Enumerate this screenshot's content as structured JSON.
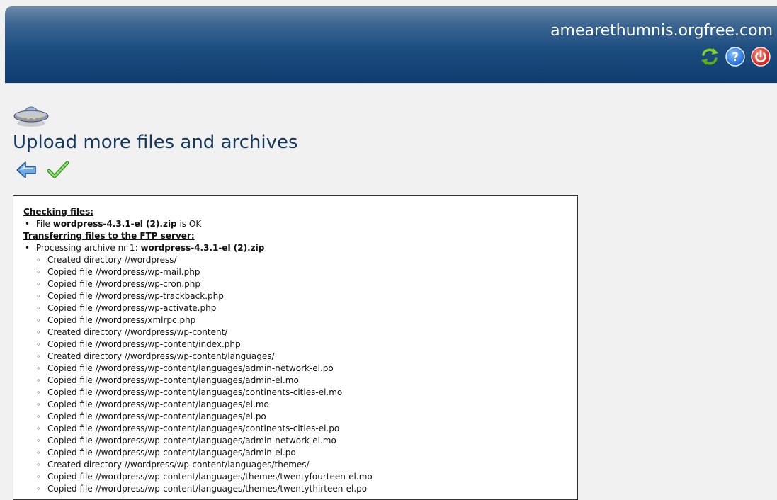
{
  "header": {
    "site_name": "amearethumnis.orgfree.com",
    "icons": [
      "refresh-icon",
      "help-icon",
      "logout-icon"
    ]
  },
  "page": {
    "title": "Upload more files and archives",
    "nav_icons": [
      "back-arrow-icon",
      "checkmark-icon"
    ]
  },
  "log": {
    "section_checking": "Checking files:",
    "file_ok_prefix": "File",
    "file_ok_name": "wordpress-4.3.1-el (2).zip",
    "file_ok_suffix": "is OK",
    "section_transfer": "Transferring files to the FTP server:",
    "processing_prefix": "Processing archive nr 1:",
    "processing_name": "wordpress-4.3.1-el (2).zip",
    "entries": [
      "Created directory //wordpress/",
      "Copied file //wordpress/wp-mail.php",
      "Copied file //wordpress/wp-cron.php",
      "Copied file //wordpress/wp-trackback.php",
      "Copied file //wordpress/wp-activate.php",
      "Copied file //wordpress/xmlrpc.php",
      "Created directory //wordpress/wp-content/",
      "Copied file //wordpress/wp-content/index.php",
      "Created directory //wordpress/wp-content/languages/",
      "Copied file //wordpress/wp-content/languages/admin-network-el.po",
      "Copied file //wordpress/wp-content/languages/admin-el.mo",
      "Copied file //wordpress/wp-content/languages/continents-cities-el.mo",
      "Copied file //wordpress/wp-content/languages/el.mo",
      "Copied file //wordpress/wp-content/languages/el.po",
      "Copied file //wordpress/wp-content/languages/continents-cities-el.po",
      "Copied file //wordpress/wp-content/languages/admin-network-el.mo",
      "Copied file //wordpress/wp-content/languages/admin-el.po",
      "Created directory //wordpress/wp-content/languages/themes/",
      "Copied file //wordpress/wp-content/languages/themes/twentyfourteen-el.mo",
      "Copied file //wordpress/wp-content/languages/themes/twentythirteen-el.po"
    ]
  }
}
